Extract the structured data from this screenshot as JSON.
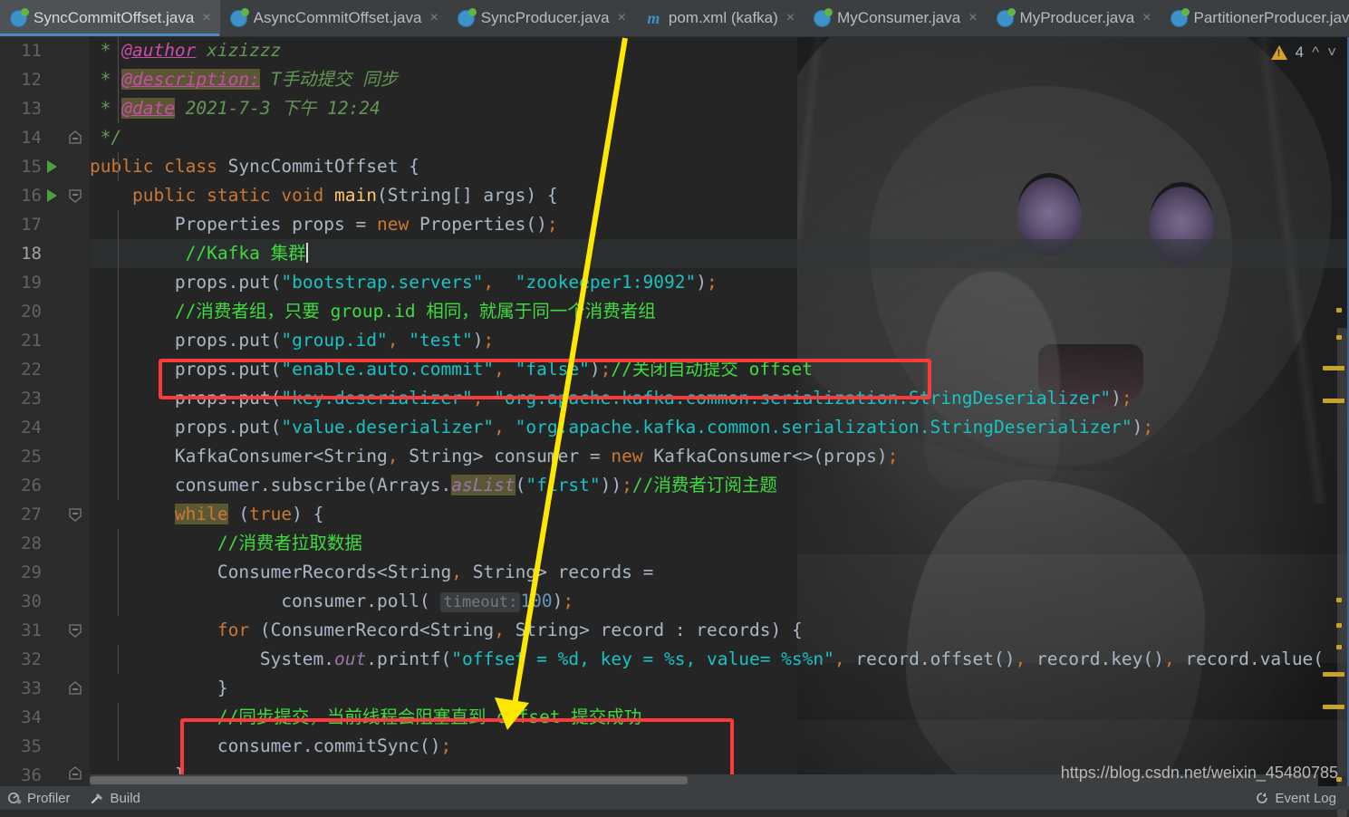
{
  "window": {
    "app": "IntelliJ IDEA",
    "watermark": "https://blog.csdn.net/weixin_45480785"
  },
  "tabs": [
    {
      "label": "SyncCommitOffset.java",
      "icon": "java-class-icon",
      "active": true,
      "close": "×"
    },
    {
      "label": "AsyncCommitOffset.java",
      "icon": "java-class-icon",
      "active": false,
      "close": "×"
    },
    {
      "label": "SyncProducer.java",
      "icon": "java-class-icon",
      "active": false,
      "close": "×"
    },
    {
      "label": "pom.xml (kafka)",
      "icon": "maven-icon",
      "active": false,
      "close": "×"
    },
    {
      "label": "MyConsumer.java",
      "icon": "java-class-icon",
      "active": false,
      "close": "×"
    },
    {
      "label": "MyProducer.java",
      "icon": "java-class-icon",
      "active": false,
      "close": "×"
    },
    {
      "label": "PartitionerProducer.java",
      "icon": "java-class-icon",
      "active": false,
      "close": "×"
    }
  ],
  "tab_overflow_icon": "chevron-down-icon",
  "inspection_widget": {
    "icon": "warning-triangle-icon",
    "count": "4",
    "prev_icon": "chevron-up-icon",
    "next_icon": "chevron-down-icon"
  },
  "editor": {
    "file": "SyncCommitOffset.java",
    "first_line": 11,
    "caret_line": 18,
    "lines": [
      {
        "no": "11",
        "run": false,
        "fold": "",
        "vline": true
      },
      {
        "no": "12",
        "run": false,
        "fold": "",
        "vline": true
      },
      {
        "no": "13",
        "run": false,
        "fold": "",
        "vline": true
      },
      {
        "no": "14",
        "run": false,
        "fold": "end",
        "vline": false
      },
      {
        "no": "15",
        "run": true,
        "fold": "",
        "vline": true
      },
      {
        "no": "16",
        "run": true,
        "fold": "start",
        "vline": false
      },
      {
        "no": "17",
        "run": false,
        "fold": "",
        "vline": true
      },
      {
        "no": "18",
        "run": false,
        "fold": "",
        "vline": true
      },
      {
        "no": "19",
        "run": false,
        "fold": "",
        "vline": true
      },
      {
        "no": "20",
        "run": false,
        "fold": "",
        "vline": true
      },
      {
        "no": "21",
        "run": false,
        "fold": "",
        "vline": true
      },
      {
        "no": "22",
        "run": false,
        "fold": "",
        "vline": true
      },
      {
        "no": "23",
        "run": false,
        "fold": "",
        "vline": true
      },
      {
        "no": "24",
        "run": false,
        "fold": "",
        "vline": true
      },
      {
        "no": "25",
        "run": false,
        "fold": "",
        "vline": true
      },
      {
        "no": "26",
        "run": false,
        "fold": "",
        "vline": true
      },
      {
        "no": "27",
        "run": false,
        "fold": "start",
        "vline": false
      },
      {
        "no": "28",
        "run": false,
        "fold": "",
        "vline": true
      },
      {
        "no": "29",
        "run": false,
        "fold": "",
        "vline": true
      },
      {
        "no": "30",
        "run": false,
        "fold": "",
        "vline": true
      },
      {
        "no": "31",
        "run": false,
        "fold": "start",
        "vline": false
      },
      {
        "no": "32",
        "run": false,
        "fold": "",
        "vline": true
      },
      {
        "no": "33",
        "run": false,
        "fold": "end",
        "vline": false
      },
      {
        "no": "34",
        "run": false,
        "fold": "",
        "vline": true
      },
      {
        "no": "35",
        "run": false,
        "fold": "",
        "vline": true
      },
      {
        "no": "36",
        "run": false,
        "fold": "end",
        "vline": false
      }
    ],
    "code_text": [
      "  * @author xizizzz",
      "  * @description: T手动提交 同步",
      "  * @date 2021-7-3 下午 12:24",
      "  */",
      "public class SyncCommitOffset {",
      "    public static void main(String[] args) {",
      "        Properties props = new Properties();",
      "        //Kafka 集群",
      "        props.put(\"bootstrap.servers\",  \"zookeeper1:9092\");",
      "        //消费者组，只要 group.id 相同，就属于同一个消费者组",
      "        props.put(\"group.id\", \"test\");",
      "        props.put(\"enable.auto.commit\", \"false\");//关闭自动提交 offset",
      "        props.put(\"key.deserializer\", \"org.apache.kafka.common.serialization.StringDeserializer\");",
      "        props.put(\"value.deserializer\", \"org.apache.kafka.common.serialization.StringDeserializer\");",
      "        KafkaConsumer<String, String> consumer = new KafkaConsumer<>(props);",
      "        consumer.subscribe(Arrays.asList(\"first\"));//消费者订阅主题",
      "        while (true) {",
      "            //消费者拉取数据",
      "            ConsumerRecords<String, String> records =",
      "                  consumer.poll( timeout: 100);",
      "            for (ConsumerRecord<String, String> record : records) {",
      "                System.out.printf(\"offset = %d, key = %s, value= %s%n\", record.offset(), record.key(), record.value(",
      "            }",
      "            //同步提交，当前线程会阻塞直到 offset 提交成功",
      "            consumer.commitSync();",
      "        }"
    ],
    "inline_hint": "timeout:"
  },
  "annotations": {
    "red_boxes": 2,
    "arrow_color": "#ffe800",
    "box_color": "#fb3b3b"
  },
  "statusbar": {
    "items": [
      {
        "label": "Profiler",
        "icon": "profiler-icon"
      },
      {
        "label": "Build",
        "icon": "hammer-icon"
      }
    ],
    "event_log": {
      "label": "Event Log",
      "icon": "event-log-icon"
    }
  },
  "colors": {
    "tab_active_underline": "#4a88c7",
    "editor_bg": "#252525",
    "gutter_bg": "#2b2b2b",
    "comment_green": "#3fdb3f",
    "string_teal": "#17c3c3",
    "keyword_orange": "#cc7832",
    "warning_yellow": "#c9a227"
  }
}
